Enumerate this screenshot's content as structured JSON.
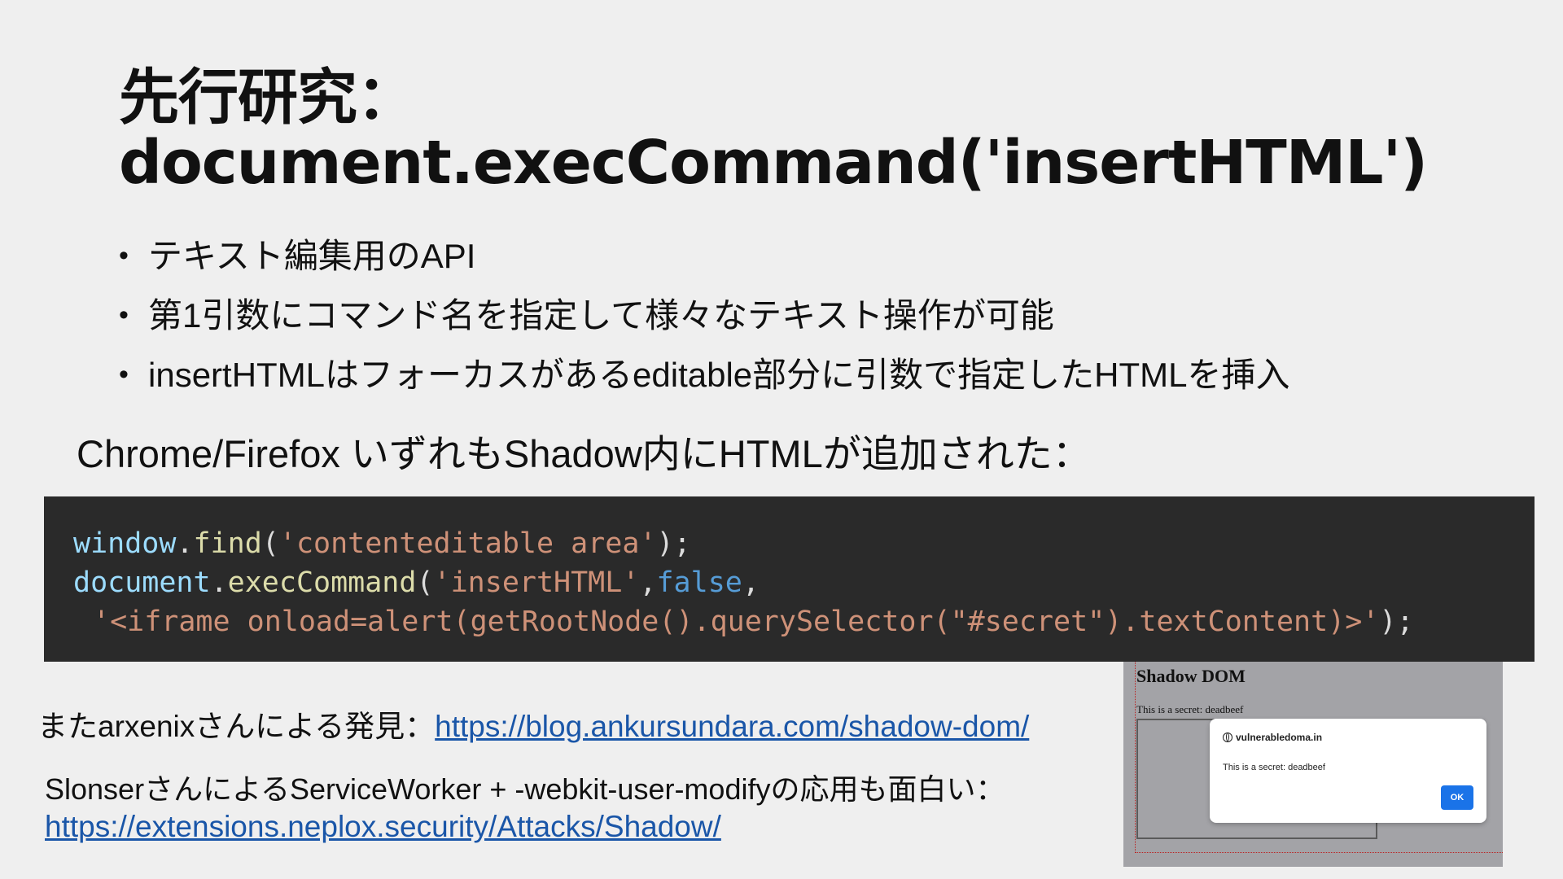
{
  "title": {
    "line1": "先行研究：",
    "line2": "document.execCommand('insertHTML')"
  },
  "bullets": [
    "テキスト編集用のAPI",
    "第1引数にコマンド名を指定して様々なテキスト操作が可能",
    "insertHTMLはフォーカスがあるeditable部分に引数で指定したHTMLを挿入"
  ],
  "bullet_glyph": "•",
  "subhead": "Chrome/Firefox いずれもShadow内にHTMLが追加された：",
  "code": {
    "l1_obj": "window",
    "l1_dot": ".",
    "l1_fn": "find",
    "l1_open": "(",
    "l1_str": "'contenteditable area'",
    "l1_close": ");",
    "l2_obj": "document",
    "l2_dot": ".",
    "l2_fn": "execCommand",
    "l2_open": "(",
    "l2_str": "'insertHTML'",
    "l2_comma": ",",
    "l2_bool": "false",
    "l2_comma2": ",",
    "l3_str": "'<iframe onload=alert(getRootNode().querySelector(\"#secret\").textContent)>'",
    "l3_close": ");"
  },
  "found": {
    "prefix": "またarxenixさんによる発見：",
    "link": "https://blog.ankursundara.com/shadow-dom/"
  },
  "slonser": {
    "text": "SlonserさんによるServiceWorker + -webkit-user-modifyの応用も面白い：",
    "link": "https://extensions.neplox.security/Attacks/Shadow/"
  },
  "screenshot": {
    "heading": "Shadow DOM",
    "secret_text": "This is a secret: deadbeef",
    "dialog_origin": "vulnerabledoma.in",
    "dialog_message": "This is a secret: deadbeef",
    "dialog_ok": "OK"
  }
}
